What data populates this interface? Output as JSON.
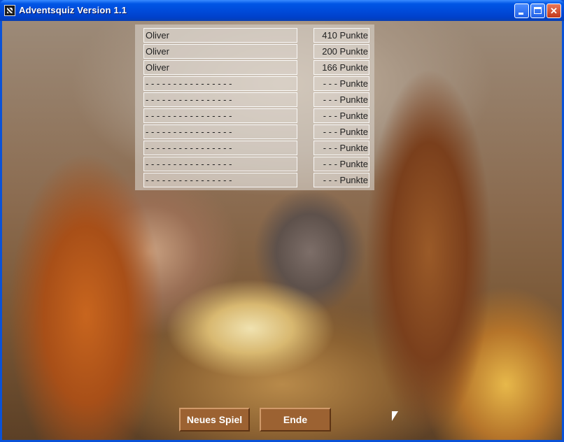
{
  "window": {
    "title": "Adventsquiz Version 1.1",
    "minimize_label": "",
    "maximize_label": "",
    "close_label": "✕"
  },
  "scores": [
    {
      "name": "Oliver",
      "points": "410 Punkte"
    },
    {
      "name": "Oliver",
      "points": "200 Punkte"
    },
    {
      "name": "Oliver",
      "points": "166 Punkte"
    },
    {
      "name": "- - - - - - - - - - - - - - - -",
      "points": "- - - Punkte"
    },
    {
      "name": "- - - - - - - - - - - - - - - -",
      "points": "- - - Punkte"
    },
    {
      "name": "- - - - - - - - - - - - - - - -",
      "points": "- - - Punkte"
    },
    {
      "name": "- - - - - - - - - - - - - - - -",
      "points": "- - - Punkte"
    },
    {
      "name": "- - - - - - - - - - - - - - - -",
      "points": "- - - Punkte"
    },
    {
      "name": "- - - - - - - - - - - - - - - -",
      "points": "- - - Punkte"
    },
    {
      "name": "- - - - - - - - - - - - - - - -",
      "points": "- - - Punkte"
    }
  ],
  "buttons": {
    "new_game": "Neues Spiel",
    "end": "Ende"
  },
  "colors": {
    "titlebar": "#0055e5",
    "button_bg": "#9c6232",
    "close_button": "#c2381a"
  },
  "icons": {
    "app": "app-icon",
    "cursor": "mouse-cursor-icon"
  }
}
